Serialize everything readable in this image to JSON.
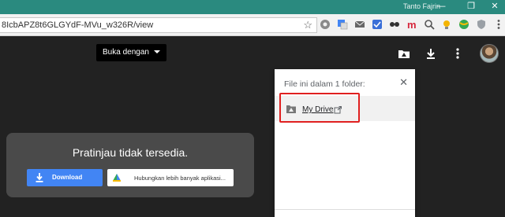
{
  "window": {
    "user_name": "Tanto Fajrin",
    "controls": [
      "minimize",
      "restore",
      "close"
    ]
  },
  "browser": {
    "url": "8IcbAPZ8t6GLGYdF-MVu_w326R/view",
    "extensions": [
      "refresh-circle-icon",
      "translate-icon",
      "mail-icon",
      "checklist-icon",
      "glasses-icon",
      "m-logo-icon",
      "search-icon",
      "bulb-icon",
      "globe-icon",
      "shield-icon",
      "menu-dots-icon"
    ]
  },
  "viewer": {
    "open_with_label": "Buka dengan",
    "top_icons": [
      "add-to-drive-icon",
      "download-icon",
      "more-vert-icon"
    ],
    "preview_message": "Pratinjau tidak tersedia.",
    "download_label": "Download",
    "connect_apps_label": "Hubungkan lebih banyak aplikasi..."
  },
  "details_panel": {
    "heading": "File ini dalam 1 folder:",
    "folder_name": "My Drive"
  },
  "colors": {
    "titlebar": "#2a8a7f",
    "accent_blue": "#4285f4",
    "highlight_red": "#e02020",
    "viewer_bg": "#222222"
  }
}
